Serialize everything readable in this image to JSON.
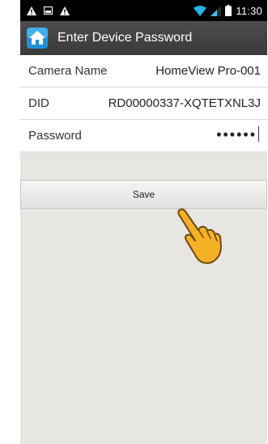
{
  "status_bar": {
    "time": "11:30",
    "left_icons": [
      "warning-icon",
      "image-icon",
      "warning-icon"
    ],
    "right_icons": [
      "wifi-icon",
      "signal-icon",
      "battery-icon"
    ]
  },
  "header": {
    "title": "Enter Device Password",
    "icon": "home-icon"
  },
  "form": {
    "camera_name": {
      "label": "Camera Name",
      "value": "HomeView Pro-001"
    },
    "did": {
      "label": "DID",
      "value": "RD00000337-XQTETXNL3J"
    },
    "password": {
      "label": "Password",
      "value": "••••••"
    }
  },
  "actions": {
    "save_label": "Save"
  },
  "colors": {
    "title_bar": "#3f3f3f",
    "background": "#e8e6e3",
    "wifi": "#2bb0e8",
    "signal": "#39c0f0",
    "hand": "#f5b125"
  }
}
